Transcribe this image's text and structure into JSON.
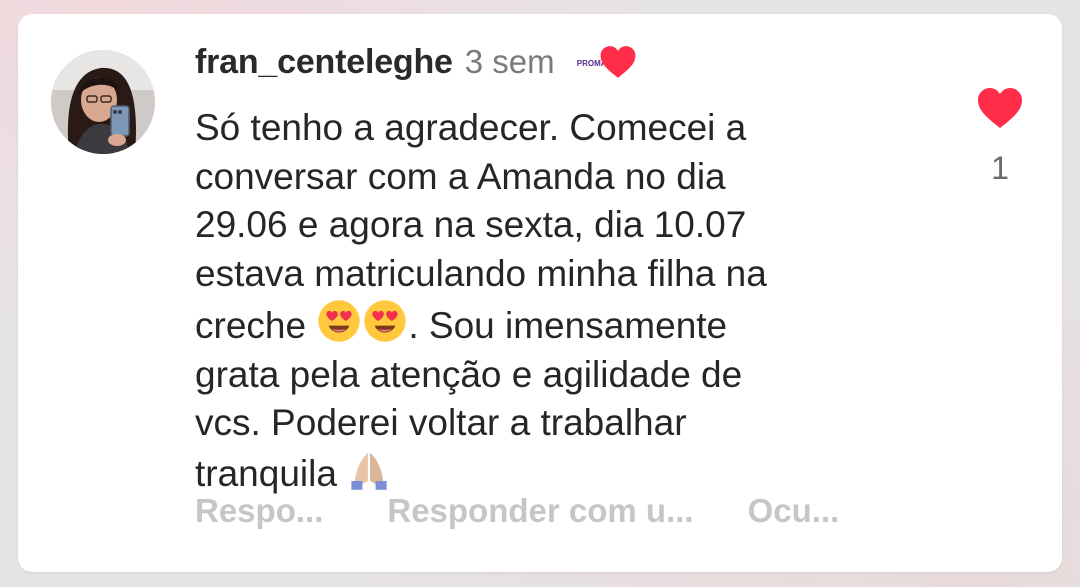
{
  "comment": {
    "username": "fran_centeleghe",
    "time": "3 sem",
    "creator_badge_text": "PROMA",
    "text_lines": [
      "Só tenho a agradecer. Comecei a",
      "conversar com a Amanda no dia",
      "29.06 e agora na sexta, dia 10.07",
      "estava matriculando minha filha na",
      "creche",
      ". Sou imensamente",
      "grata pela atenção e agilidade de",
      "vcs. Poderei voltar a trabalhar",
      "tranquila"
    ],
    "emojis": [
      "heart-eyes-face",
      "heart-eyes-face",
      "folded-hands"
    ],
    "like_count": "1",
    "actions": {
      "reply": "Respo...",
      "reply_with": "Responder com u...",
      "hide": "Ocu..."
    }
  },
  "colors": {
    "heart": "#ff2d48",
    "username": "#2a2a2a",
    "muted": "#7a7a7a",
    "action": "#c6c6c6",
    "card": "#ffffff"
  },
  "icons": [
    "heart-icon",
    "creator-heart-icon",
    "heart-eyes-emoji",
    "folded-hands-emoji"
  ]
}
